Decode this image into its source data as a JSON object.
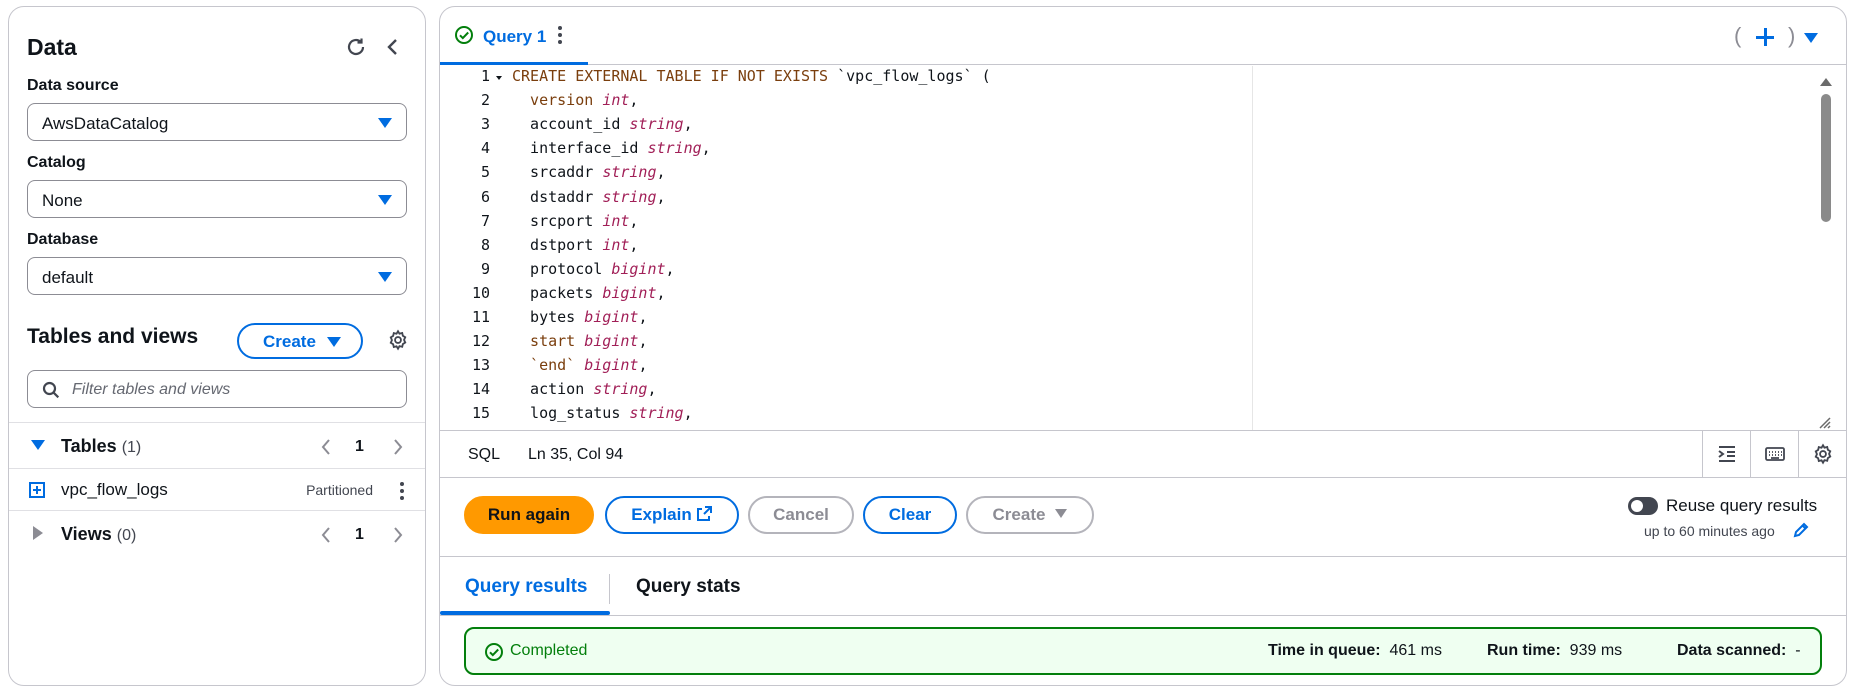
{
  "left": {
    "title": "Data",
    "data_source_label": "Data source",
    "data_source_value": "AwsDataCatalog",
    "catalog_label": "Catalog",
    "catalog_value": "None",
    "database_label": "Database",
    "database_value": "default",
    "tables_views_title": "Tables and views",
    "create_label": "Create",
    "filter_placeholder": "Filter tables and views",
    "tables_label": "Tables",
    "tables_count": "(1)",
    "tables_page": "1",
    "table_name": "vpc_flow_logs",
    "table_badge": "Partitioned",
    "views_label": "Views",
    "views_count": "(0)",
    "views_page": "1"
  },
  "tab": {
    "label": "Query 1"
  },
  "tabbar_right": {
    "open_paren": "(",
    "close_paren": ")"
  },
  "editor": {
    "lines": [
      {
        "n": "1",
        "parts": [
          [
            "kw",
            "CREATE EXTERNAL TABLE IF NOT EXISTS "
          ],
          [
            "st",
            "`vpc_flow_logs`"
          ],
          [
            "st",
            " ("
          ]
        ]
      },
      {
        "n": "2",
        "parts": [
          [
            "kw",
            "  version "
          ],
          [
            "ty",
            "int"
          ],
          [
            "st",
            ","
          ]
        ]
      },
      {
        "n": "3",
        "parts": [
          [
            "st",
            "  account_id "
          ],
          [
            "ty",
            "string"
          ],
          [
            "st",
            ","
          ]
        ]
      },
      {
        "n": "4",
        "parts": [
          [
            "st",
            "  interface_id "
          ],
          [
            "ty",
            "string"
          ],
          [
            "st",
            ","
          ]
        ]
      },
      {
        "n": "5",
        "parts": [
          [
            "st",
            "  srcaddr "
          ],
          [
            "ty",
            "string"
          ],
          [
            "st",
            ","
          ]
        ]
      },
      {
        "n": "6",
        "parts": [
          [
            "st",
            "  dstaddr "
          ],
          [
            "ty",
            "string"
          ],
          [
            "st",
            ","
          ]
        ]
      },
      {
        "n": "7",
        "parts": [
          [
            "st",
            "  srcport "
          ],
          [
            "ty",
            "int"
          ],
          [
            "st",
            ","
          ]
        ]
      },
      {
        "n": "8",
        "parts": [
          [
            "st",
            "  dstport "
          ],
          [
            "ty",
            "int"
          ],
          [
            "st",
            ","
          ]
        ]
      },
      {
        "n": "9",
        "parts": [
          [
            "st",
            "  protocol "
          ],
          [
            "ty",
            "bigint"
          ],
          [
            "st",
            ","
          ]
        ]
      },
      {
        "n": "10",
        "parts": [
          [
            "st",
            "  packets "
          ],
          [
            "ty",
            "bigint"
          ],
          [
            "st",
            ","
          ]
        ]
      },
      {
        "n": "11",
        "parts": [
          [
            "st",
            "  bytes "
          ],
          [
            "ty",
            "bigint"
          ],
          [
            "st",
            ","
          ]
        ]
      },
      {
        "n": "12",
        "parts": [
          [
            "kw",
            "  start "
          ],
          [
            "ty",
            "bigint"
          ],
          [
            "st",
            ","
          ]
        ]
      },
      {
        "n": "13",
        "parts": [
          [
            "kw",
            "  `end` "
          ],
          [
            "ty",
            "bigint"
          ],
          [
            "st",
            ","
          ]
        ]
      },
      {
        "n": "14",
        "parts": [
          [
            "st",
            "  action "
          ],
          [
            "ty",
            "string"
          ],
          [
            "st",
            ","
          ]
        ]
      },
      {
        "n": "15",
        "parts": [
          [
            "st",
            "  log_status "
          ],
          [
            "ty",
            "string"
          ],
          [
            "st",
            ","
          ]
        ]
      }
    ]
  },
  "status": {
    "language": "SQL",
    "cursor": "Ln 35, Col 94"
  },
  "actions": {
    "run_again": "Run again",
    "explain": "Explain",
    "cancel": "Cancel",
    "clear": "Clear",
    "create": "Create",
    "reuse_label": "Reuse query results",
    "reuse_sub": "up to 60 minutes ago"
  },
  "results": {
    "tab_results": "Query results",
    "tab_stats": "Query stats",
    "status": "Completed",
    "time_in_queue_label": "Time in queue:",
    "time_in_queue_value": "461 ms",
    "run_time_label": "Run time:",
    "run_time_value": "939 ms",
    "data_scanned_label": "Data scanned:",
    "data_scanned_value": "-"
  },
  "colors": {
    "accent": "#006ce0",
    "primary_button": "#ff9900",
    "success": "#037f0c"
  }
}
